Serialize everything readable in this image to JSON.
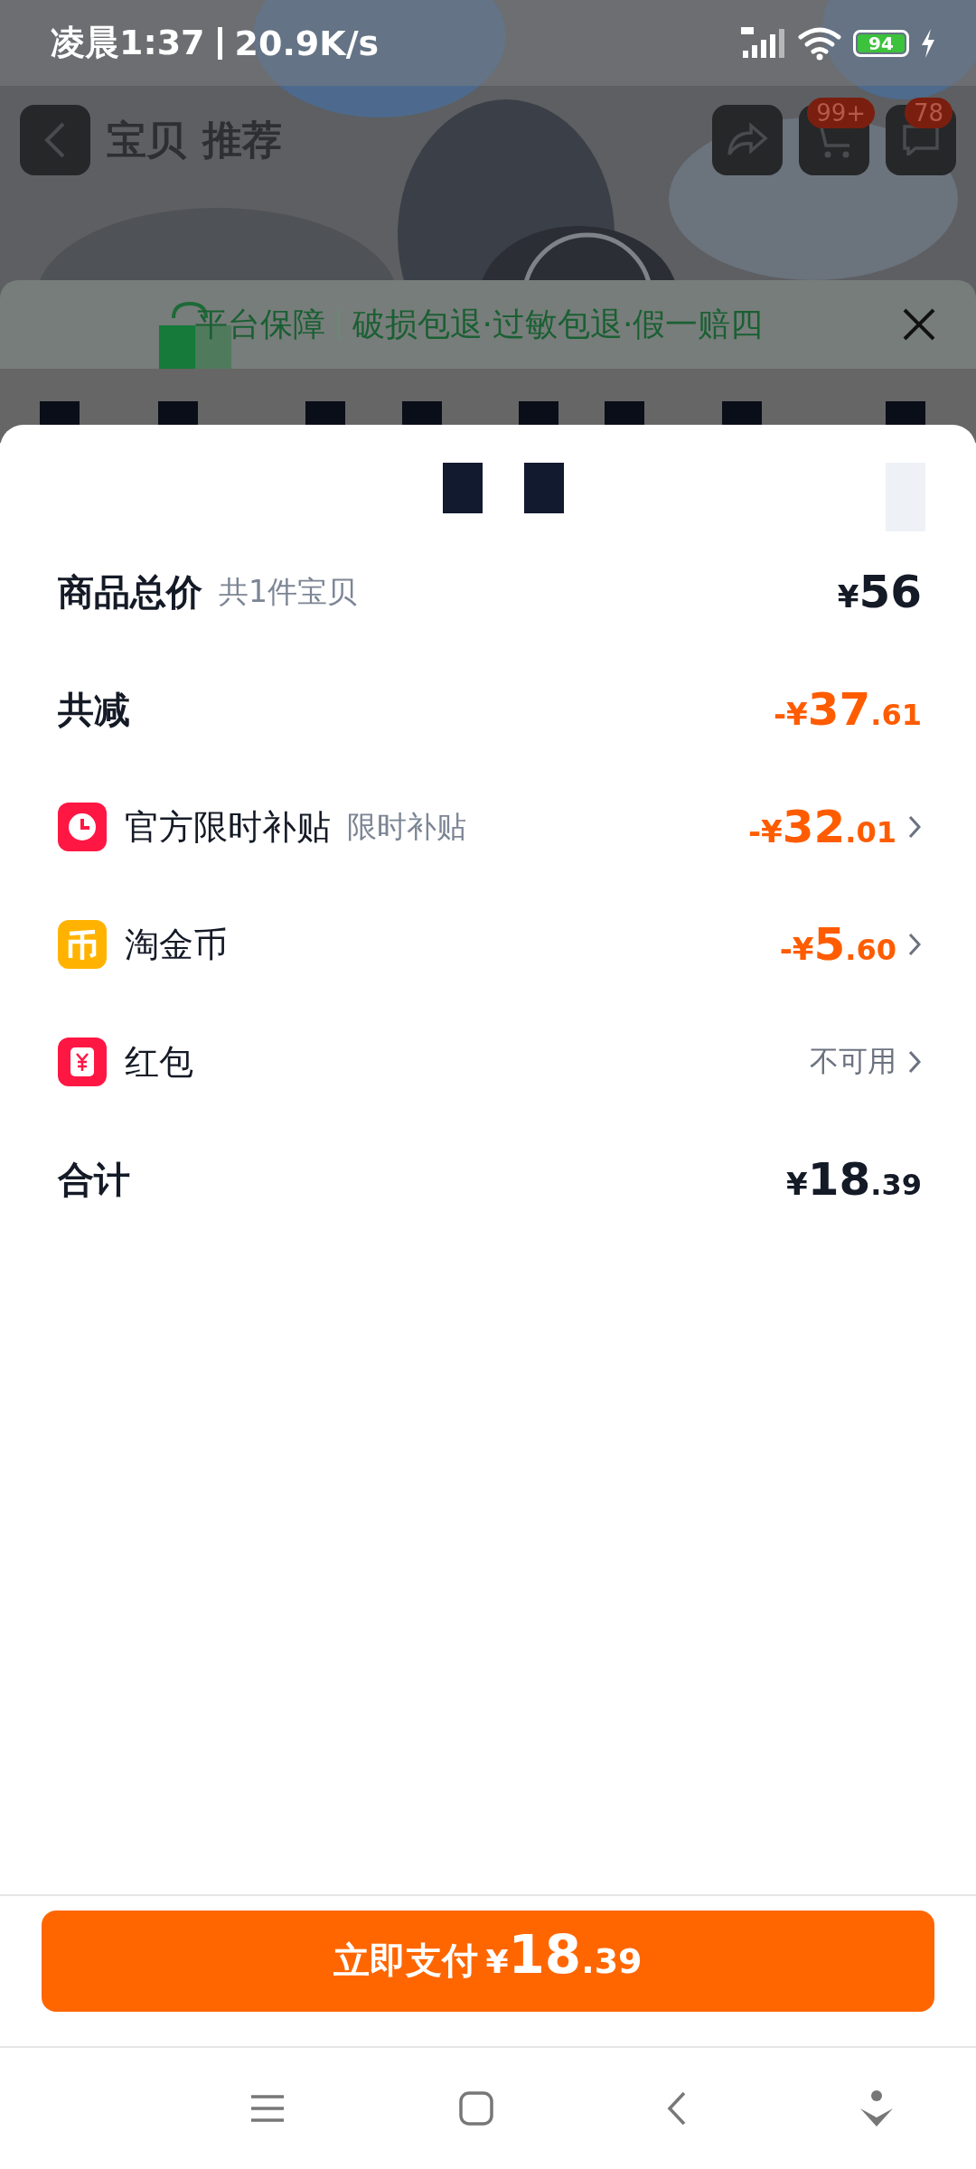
{
  "status_bar": {
    "time": "凌晨1:37",
    "speed": "20.9K/s",
    "battery": "94"
  },
  "header": {
    "tabs": [
      "宝贝",
      "推荐"
    ],
    "badges": [
      "99+",
      "78"
    ]
  },
  "guarantee_banner": {
    "title": "平台保障",
    "text": "破损包退·过敏包退·假一赔四"
  },
  "rows": [
    {
      "kind": "price",
      "label": "商品总价",
      "note": "共1件宝贝",
      "amount": "¥56"
    },
    {
      "kind": "discount",
      "label": "共减",
      "amount": "-¥37.61"
    },
    {
      "kind": "subsidy",
      "label": "官方限时补贴",
      "note": "限时补贴",
      "amount": "-¥32.01"
    },
    {
      "kind": "coins",
      "label": "淘金币",
      "amount": "-¥5.60"
    },
    {
      "kind": "packet",
      "label": "红包",
      "amount": "不可用"
    },
    {
      "kind": "price",
      "label": "合计",
      "amount": "¥18.39"
    }
  ],
  "pay_button": {
    "label": "立即支付",
    "amount": "¥18.39"
  }
}
